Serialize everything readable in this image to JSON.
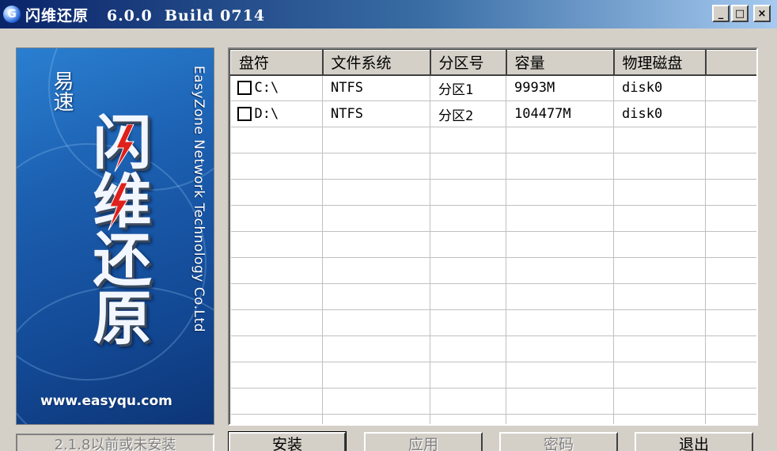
{
  "window": {
    "title": "闪维还原   6.0.0  Build 0714",
    "icon_letter": "G",
    "controls": {
      "minimize": "_",
      "maximize": "□",
      "close": "×"
    }
  },
  "banner": {
    "brand_small": "易速",
    "brand_big": "闪维还原",
    "company_en": "EasyZone Network Technology Co.Ltd",
    "url": "www.easyqu.com",
    "colors": {
      "bg": "#1c5fb0",
      "bolt": "#e0201a"
    }
  },
  "table": {
    "columns": [
      "盘符",
      "文件系统",
      "分区号",
      "容量",
      "物理磁盘",
      ""
    ],
    "rows": [
      {
        "checked": false,
        "drive": "C:\\",
        "fs": "NTFS",
        "partition": "分区1",
        "size": "9993M",
        "disk": "disk0"
      },
      {
        "checked": false,
        "drive": "D:\\",
        "fs": "NTFS",
        "partition": "分区2",
        "size": "104477M",
        "disk": "disk0"
      }
    ]
  },
  "status": {
    "text": "2.1.8以前或未安装"
  },
  "buttons": {
    "install": "安装",
    "apply": "应用",
    "password": "密码",
    "exit": "退出"
  }
}
